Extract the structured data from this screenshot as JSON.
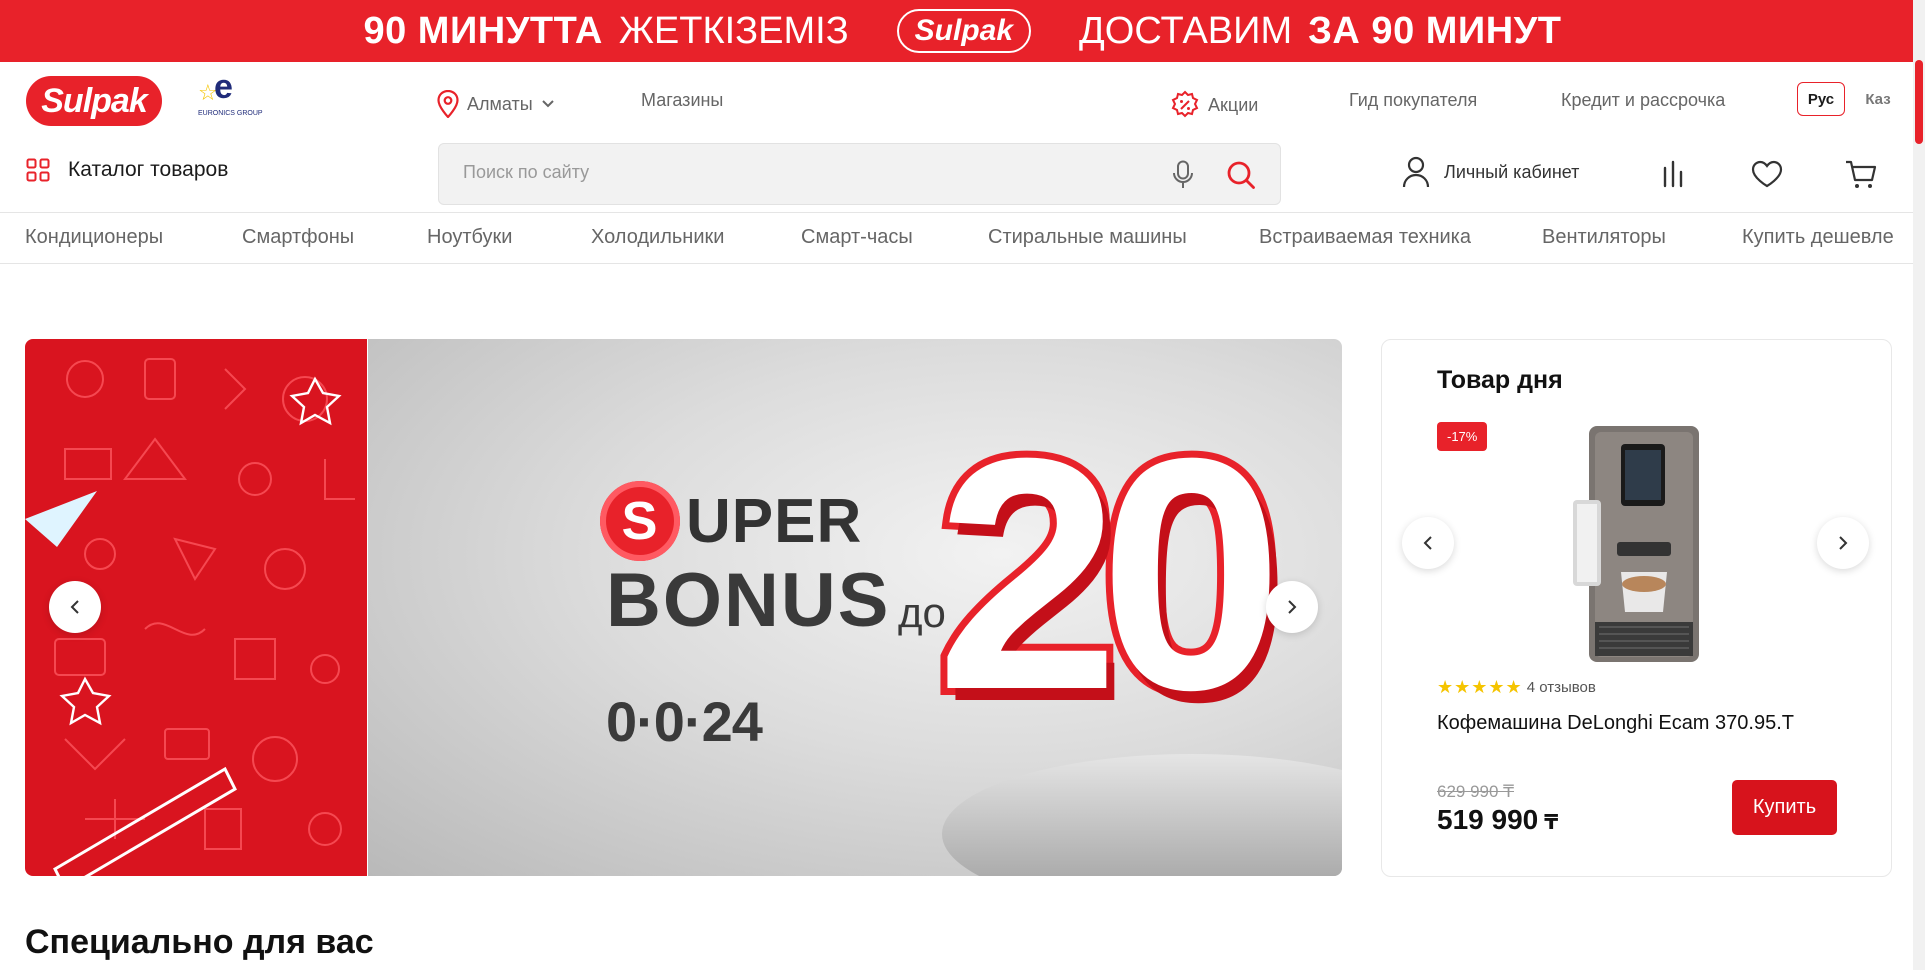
{
  "promo": {
    "left_bold": "90 МИНУТТА",
    "left_thin": "ЖЕТКІЗЕМІЗ",
    "logo": "Sulpak",
    "right_thin": "ДОСТАВИМ",
    "right_bold": "ЗА 90 МИНУТ"
  },
  "header": {
    "logo": "Sulpak",
    "euronics_label": "EURONICS GROUP",
    "city": "Алматы",
    "stores": "Магазины",
    "promotions": "Акции",
    "buyer_guide": "Гид покупателя",
    "credit": "Кредит и рассрочка",
    "lang_ru": "Рус",
    "lang_kz": "Каз"
  },
  "toolbar": {
    "catalog": "Каталог товаров",
    "search_placeholder": "Поиск по сайту",
    "account": "Личный кабинет"
  },
  "categories": [
    "Кондиционеры",
    "Смартфоны",
    "Ноутбуки",
    "Холодильники",
    "Смарт-часы",
    "Стиральные машины",
    "Встраиваемая техника",
    "Вентиляторы",
    "Купить дешевле"
  ],
  "banner": {
    "super_letter": "S",
    "super_rest": "UPER",
    "bonus": "BONUS",
    "do": "до",
    "timer": "0·0·24",
    "big_number": "20"
  },
  "product_of_day": {
    "title": "Товар дня",
    "discount": "-17%",
    "rating": 5,
    "reviews": "4 отзывов",
    "name": "Кофемашина DeLonghi Ecam 370.95.T",
    "old_price": "629 990 ₸",
    "price": "519 990",
    "currency": "₸",
    "buy_label": "Купить"
  },
  "sections": {
    "special": "Специально для вас"
  },
  "colors": {
    "brand_red": "#e8222a",
    "buy_red": "#d7131c"
  }
}
